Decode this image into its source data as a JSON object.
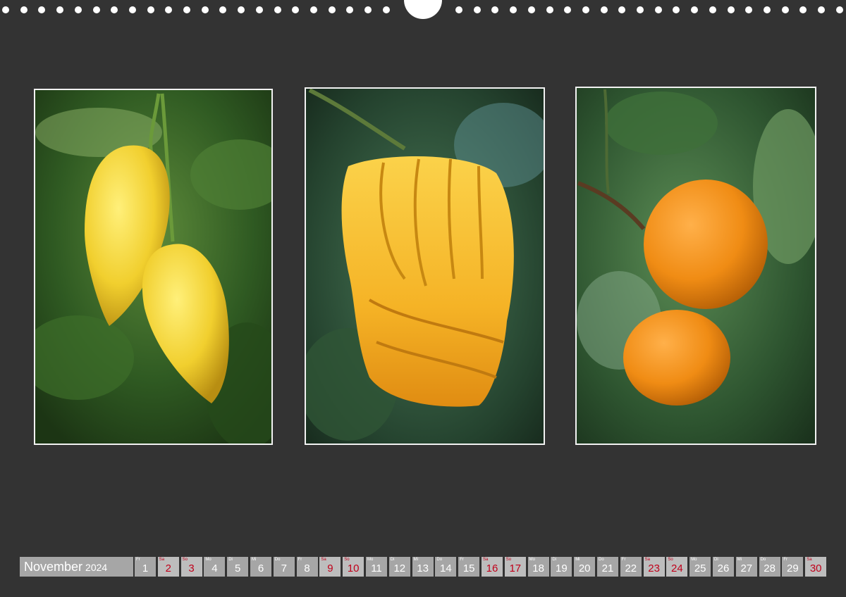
{
  "calendar": {
    "month": "November",
    "year": "2024",
    "days": [
      {
        "wd": "Fr",
        "num": "1",
        "weekend": false
      },
      {
        "wd": "Sa",
        "num": "2",
        "weekend": true
      },
      {
        "wd": "So",
        "num": "3",
        "weekend": true
      },
      {
        "wd": "Mo",
        "num": "4",
        "weekend": false
      },
      {
        "wd": "Di",
        "num": "5",
        "weekend": false
      },
      {
        "wd": "Mi",
        "num": "6",
        "weekend": false
      },
      {
        "wd": "Do",
        "num": "7",
        "weekend": false
      },
      {
        "wd": "Fr",
        "num": "8",
        "weekend": false
      },
      {
        "wd": "Sa",
        "num": "9",
        "weekend": true
      },
      {
        "wd": "So",
        "num": "10",
        "weekend": true
      },
      {
        "wd": "Mo",
        "num": "11",
        "weekend": false
      },
      {
        "wd": "Di",
        "num": "12",
        "weekend": false
      },
      {
        "wd": "Mi",
        "num": "13",
        "weekend": false
      },
      {
        "wd": "Do",
        "num": "14",
        "weekend": false
      },
      {
        "wd": "Fr",
        "num": "15",
        "weekend": false
      },
      {
        "wd": "Sa",
        "num": "16",
        "weekend": true
      },
      {
        "wd": "So",
        "num": "17",
        "weekend": true
      },
      {
        "wd": "Mo",
        "num": "18",
        "weekend": false
      },
      {
        "wd": "Di",
        "num": "19",
        "weekend": false
      },
      {
        "wd": "Mi",
        "num": "20",
        "weekend": false
      },
      {
        "wd": "Do",
        "num": "21",
        "weekend": false
      },
      {
        "wd": "Fr",
        "num": "22",
        "weekend": false
      },
      {
        "wd": "Sa",
        "num": "23",
        "weekend": true
      },
      {
        "wd": "So",
        "num": "24",
        "weekend": true
      },
      {
        "wd": "Mo",
        "num": "25",
        "weekend": false
      },
      {
        "wd": "Di",
        "num": "26",
        "weekend": false
      },
      {
        "wd": "Mi",
        "num": "27",
        "weekend": false
      },
      {
        "wd": "Do",
        "num": "28",
        "weekend": false
      },
      {
        "wd": "Fr",
        "num": "29",
        "weekend": false
      },
      {
        "wd": "Sa",
        "num": "30",
        "weekend": true
      }
    ]
  },
  "colors": {
    "page_background": "#333333",
    "cell_gray": "#a6a6a6",
    "weekend_red": "#c0001a"
  }
}
